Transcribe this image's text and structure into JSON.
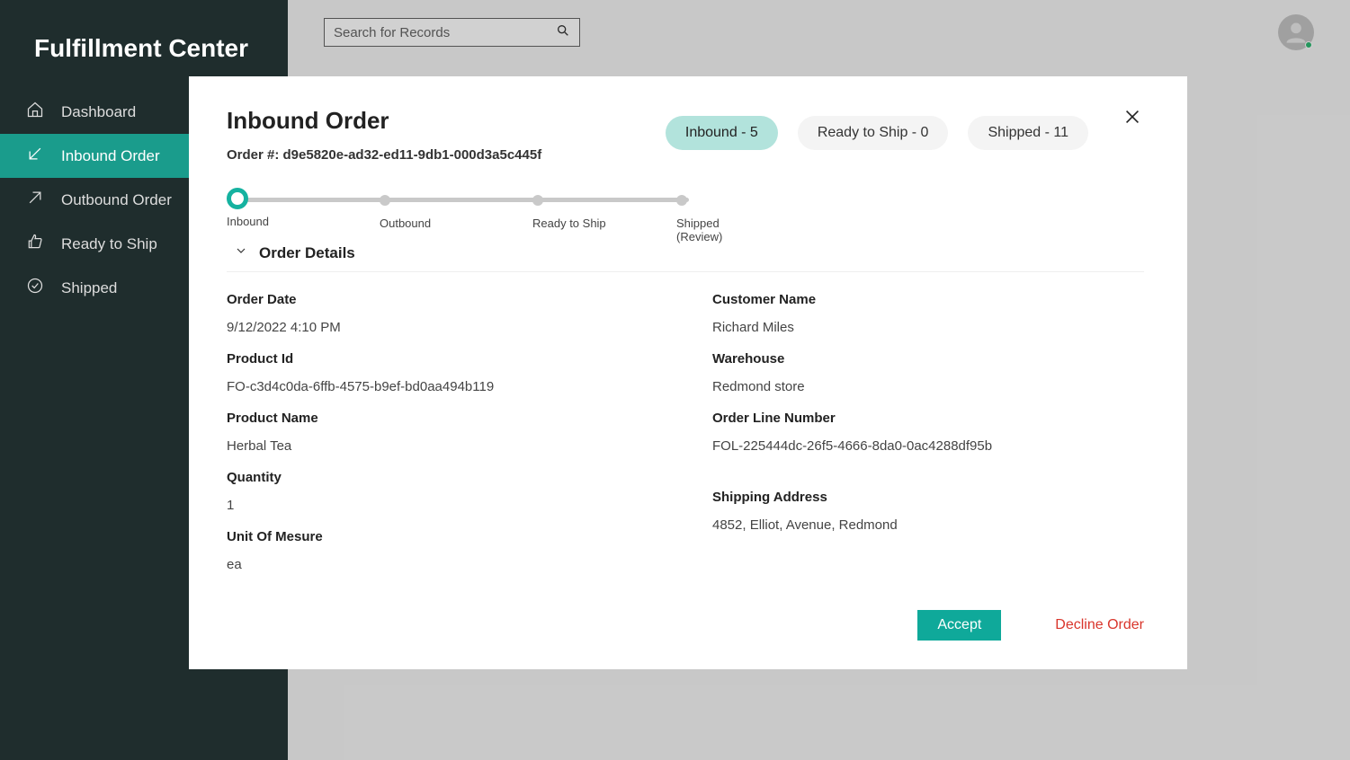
{
  "app_title": "Fulfillment Center",
  "search": {
    "placeholder": "Search for Records"
  },
  "nav": {
    "dashboard": "Dashboard",
    "inbound": "Inbound Order",
    "outbound": "Outbound Order",
    "ready": "Ready to Ship",
    "shipped": "Shipped"
  },
  "modal": {
    "title": "Inbound Order",
    "order_number_label": "Order #: d9e5820e-ad32-ed11-9db1-000d3a5c445f",
    "pills": {
      "inbound": "Inbound - 5",
      "ready": "Ready to Ship - 0",
      "shipped": "Shipped - 11"
    },
    "steps": {
      "s1": "Inbound",
      "s2": "Outbound",
      "s3": "Ready to Ship",
      "s4": "Shipped (Review)"
    },
    "section_title": "Order Details",
    "labels": {
      "order_date": "Order Date",
      "product_id": "Product Id",
      "product_name": "Product Name",
      "quantity": "Quantity",
      "uom": "Unit Of Mesure",
      "customer_name": "Customer Name",
      "warehouse": "Warehouse",
      "order_line": "Order Line Number",
      "shipping_addr": "Shipping Address"
    },
    "values": {
      "order_date": "9/12/2022 4:10 PM",
      "product_id": "FO-c3d4c0da-6ffb-4575-b9ef-bd0aa494b119",
      "product_name": "Herbal Tea",
      "quantity": "1",
      "uom": "ea",
      "customer_name": "Richard Miles",
      "warehouse": "Redmond store",
      "order_line": "FOL-225444dc-26f5-4666-8da0-0ac4288df95b",
      "shipping_addr": "4852, Elliot, Avenue, Redmond"
    },
    "buttons": {
      "accept": "Accept",
      "decline": "Decline Order"
    }
  }
}
